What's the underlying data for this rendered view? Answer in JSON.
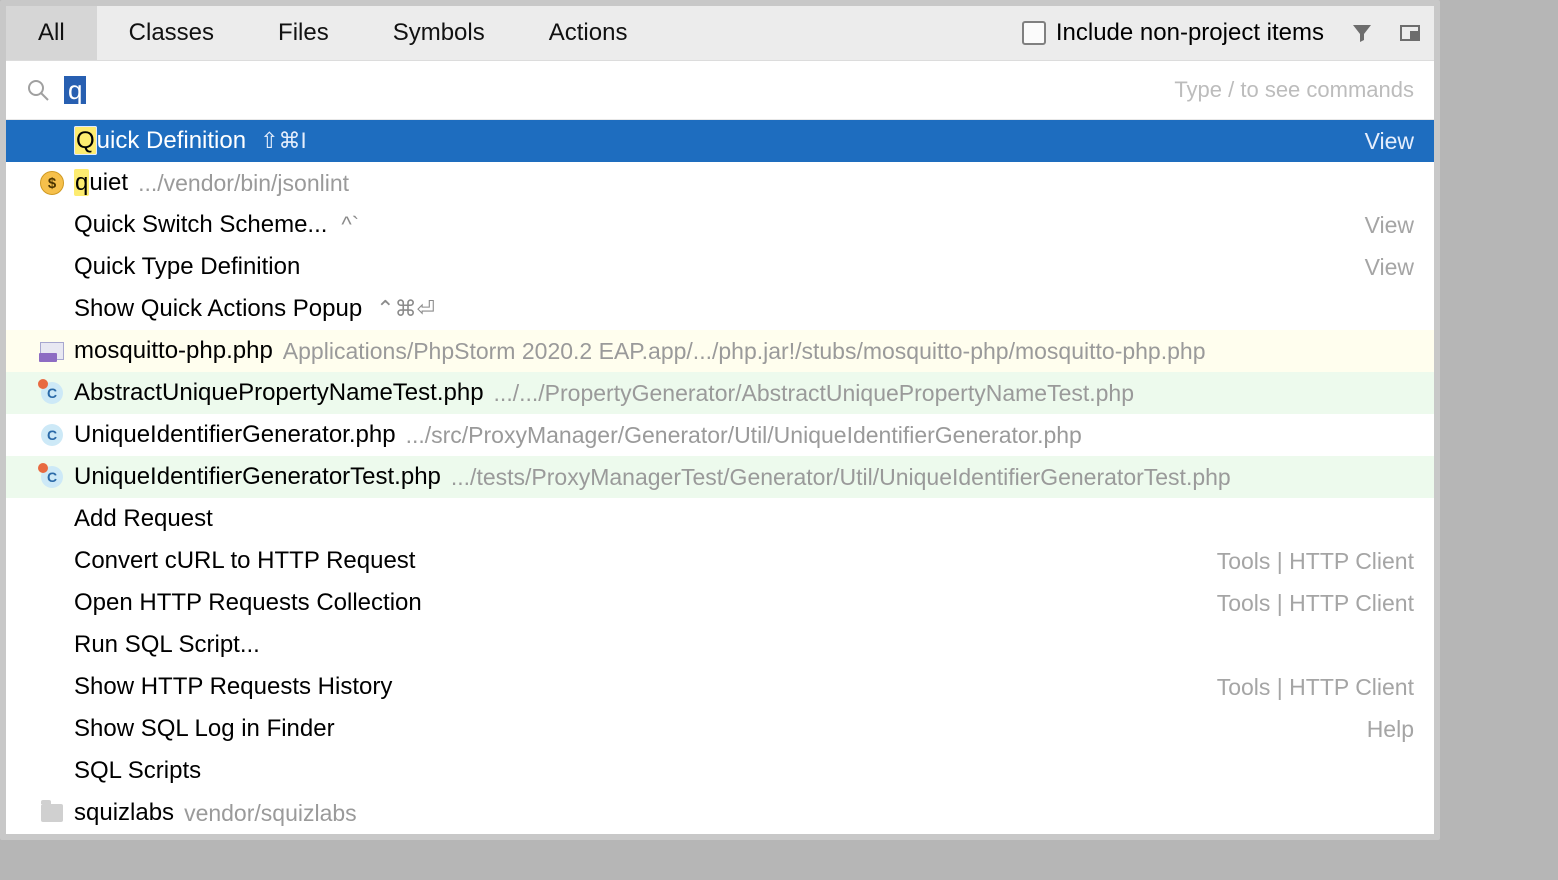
{
  "tabs": {
    "all": "All",
    "classes": "Classes",
    "files": "Files",
    "symbols": "Symbols",
    "actions": "Actions"
  },
  "options": {
    "include_non_project": "Include non-project items"
  },
  "search": {
    "query": "q",
    "hint": "Type / to see commands"
  },
  "results": [
    {
      "icon": null,
      "prefix_hl": "Q",
      "label_rest": "uick Definition",
      "shortcut": "⇧⌘I",
      "right": "View",
      "selected": true
    },
    {
      "icon": "dollar",
      "prefix_hl": "q",
      "label_rest": "uiet",
      "path": ".../vendor/bin/jsonlint"
    },
    {
      "icon": null,
      "label": "Quick Switch Scheme...",
      "shortcut": "^`",
      "right": "View"
    },
    {
      "icon": null,
      "label": "Quick Type Definition",
      "right": "View"
    },
    {
      "icon": null,
      "label": "Show Quick Actions Popup",
      "shortcut": "⌃⌘⏎"
    },
    {
      "icon": "php",
      "label": "mosquitto-php.php",
      "path": "Applications/PhpStorm 2020.2 EAP.app/.../php.jar!/stubs/mosquitto-php/mosquitto-php.php",
      "bg": "yellow"
    },
    {
      "icon": "class-test",
      "label": "AbstractUniquePropertyNameTest.php",
      "path": ".../.../PropertyGenerator/AbstractUniquePropertyNameTest.php",
      "bg": "green"
    },
    {
      "icon": "class",
      "label": "UniqueIdentifierGenerator.php",
      "path": ".../src/ProxyManager/Generator/Util/UniqueIdentifierGenerator.php"
    },
    {
      "icon": "class-test",
      "label": "UniqueIdentifierGeneratorTest.php",
      "path": ".../tests/ProxyManagerTest/Generator/Util/UniqueIdentifierGeneratorTest.php",
      "bg": "green"
    },
    {
      "icon": null,
      "label": "Add Request"
    },
    {
      "icon": null,
      "label": "Convert cURL to HTTP Request",
      "right": "Tools | HTTP Client"
    },
    {
      "icon": null,
      "label": "Open HTTP Requests Collection",
      "right": "Tools | HTTP Client"
    },
    {
      "icon": null,
      "label": "Run SQL Script..."
    },
    {
      "icon": null,
      "label": "Show HTTP Requests History",
      "right": "Tools | HTTP Client"
    },
    {
      "icon": null,
      "label": "Show SQL Log in Finder",
      "right": "Help"
    },
    {
      "icon": null,
      "label": "SQL Scripts"
    },
    {
      "icon": "folder",
      "label": "squizlabs",
      "path": "vendor/squizlabs"
    }
  ]
}
